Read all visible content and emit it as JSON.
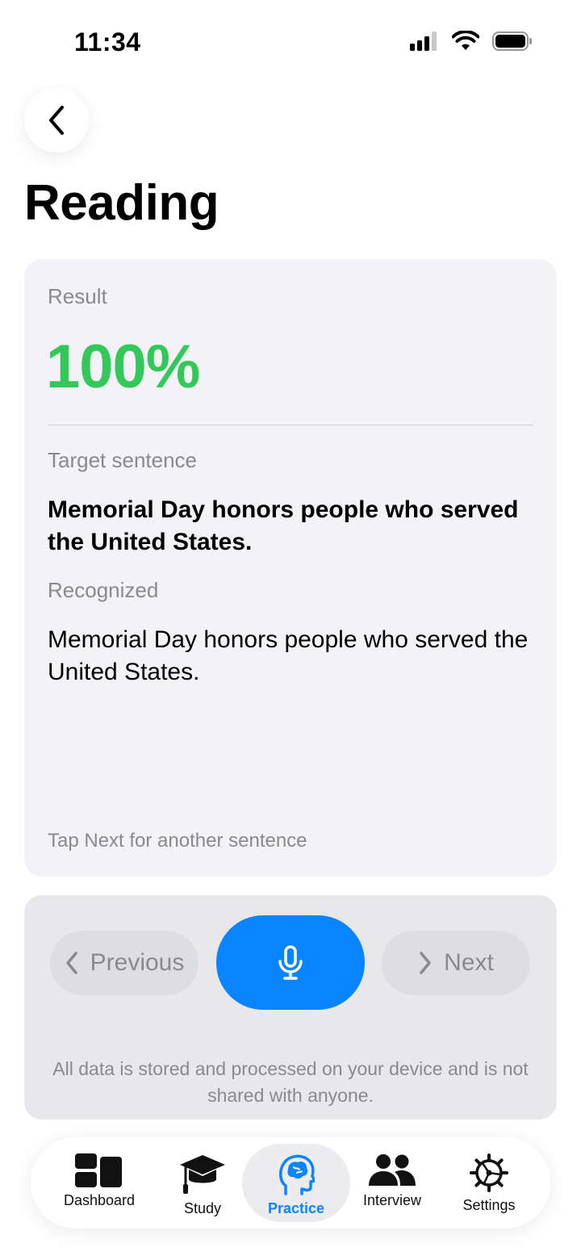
{
  "status_bar": {
    "time": "11:34"
  },
  "page": {
    "title": "Reading"
  },
  "result_card": {
    "result_label": "Result",
    "result_value": "100%",
    "target_label": "Target sentence",
    "target_text": "Memorial Day honors people who served the United States.",
    "recognized_label": "Recognized",
    "recognized_text": "Memorial Day honors people who served the United States.",
    "hint": "Tap Next for another sentence"
  },
  "controls": {
    "previous_label": "Previous",
    "next_label": "Next",
    "privacy_note": "All data is stored and processed on your device and is not shared with anyone."
  },
  "tab_bar": {
    "items": [
      {
        "label": "Dashboard",
        "icon": "dashboard-icon"
      },
      {
        "label": "Study",
        "icon": "graduation-cap-icon"
      },
      {
        "label": "Practice",
        "icon": "brain-head-icon",
        "active": true
      },
      {
        "label": "Interview",
        "icon": "people-icon"
      },
      {
        "label": "Settings",
        "icon": "gear-icon"
      }
    ]
  },
  "colors": {
    "accent": "#0a84ff",
    "success": "#34c759",
    "card_bg": "#f2f2f7",
    "secondary_text": "#8a8a8e"
  }
}
